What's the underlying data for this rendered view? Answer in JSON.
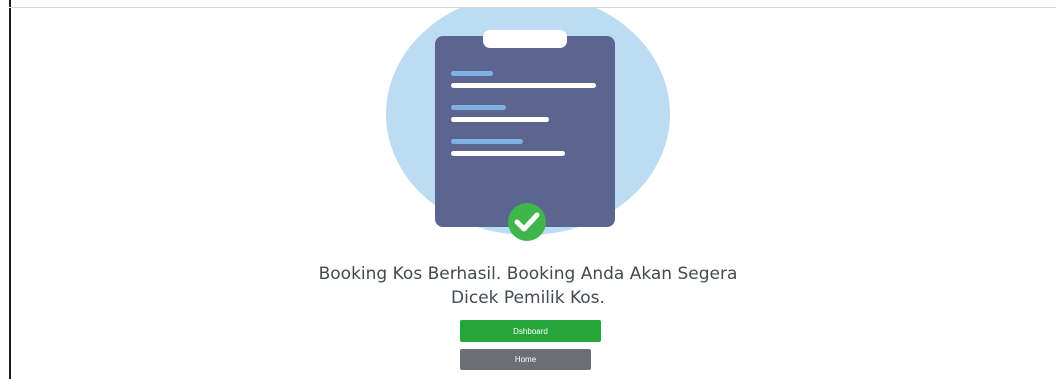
{
  "message": {
    "line1": "Booking Kos Berhasil. Booking Anda Akan Segera",
    "line2": "Dicek Pemilik Kos."
  },
  "buttons": {
    "dashboard_label": "Dshboard",
    "home_label": "Home"
  },
  "colors": {
    "circle_bg": "#bcdcf3",
    "clipboard": "#5b6590",
    "accent_line": "#7fb0e3",
    "check_badge": "#3fb54a",
    "dashboard_button": "#27a63a",
    "home_button": "#6b6f75",
    "text": "#444a52"
  },
  "illustration": {
    "icon": "clipboard-check-icon"
  }
}
